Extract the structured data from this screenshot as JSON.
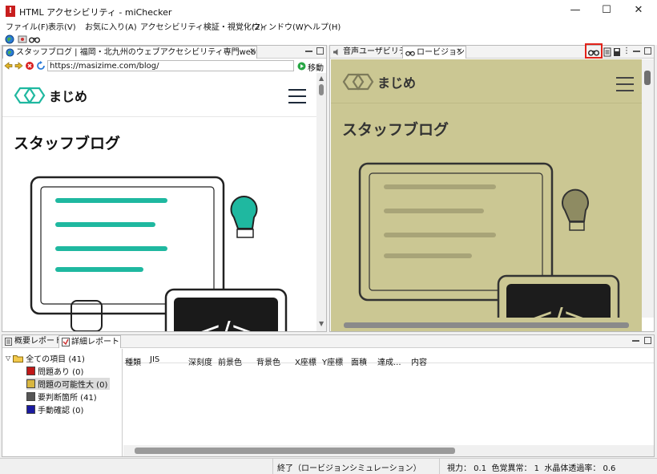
{
  "window": {
    "title": "HTML アクセシビリティ - miChecker",
    "minimize": "—",
    "maximize": "☐",
    "close": "✕"
  },
  "menu": [
    "ファイル(F)",
    "表示(V)",
    "お気に入り(A)",
    "アクセシビリティ検証・視覚化(Z)",
    "ウィンドウ(W)",
    "ヘルプ(H)"
  ],
  "browser": {
    "tab_title": "スタッフブログ | 福岡・北九州のウェブアクセシビリティ専門web制作会社",
    "url": "https://masizime.com/blog/",
    "go_label": "移動"
  },
  "preview_tabs": [
    "音声ユーザビリティ",
    "ロービジョン"
  ],
  "site": {
    "logo": "まじめ",
    "heading": "スタッフブログ"
  },
  "bottom_tabs": [
    "概要レポート",
    "詳細レポート"
  ],
  "tree": {
    "root": "全ての項目 (41)",
    "items": [
      {
        "label": "問題あり (0)",
        "color": "#c01818"
      },
      {
        "label": "問題の可能性大 (0)",
        "color": "#d8b640"
      },
      {
        "label": "要判断箇所 (41)",
        "color": "#555555"
      },
      {
        "label": "手動確認 (0)",
        "color": "#1a1aa0"
      }
    ]
  },
  "columns": [
    "種類",
    "JIS",
    "深刻度",
    "前景色",
    "背景色",
    "X座標",
    "Y座標",
    "面積",
    "達成...",
    "内容"
  ],
  "status": {
    "message": "終了（ロービジョンシミュレーション）",
    "params": "視力： 0.1  色覚異常： 1  水晶体透過率： 0.6"
  },
  "colors": {
    "accent": "#1fb8a0",
    "sim_bg": "#cbc793",
    "highlight": "#e2231a"
  }
}
